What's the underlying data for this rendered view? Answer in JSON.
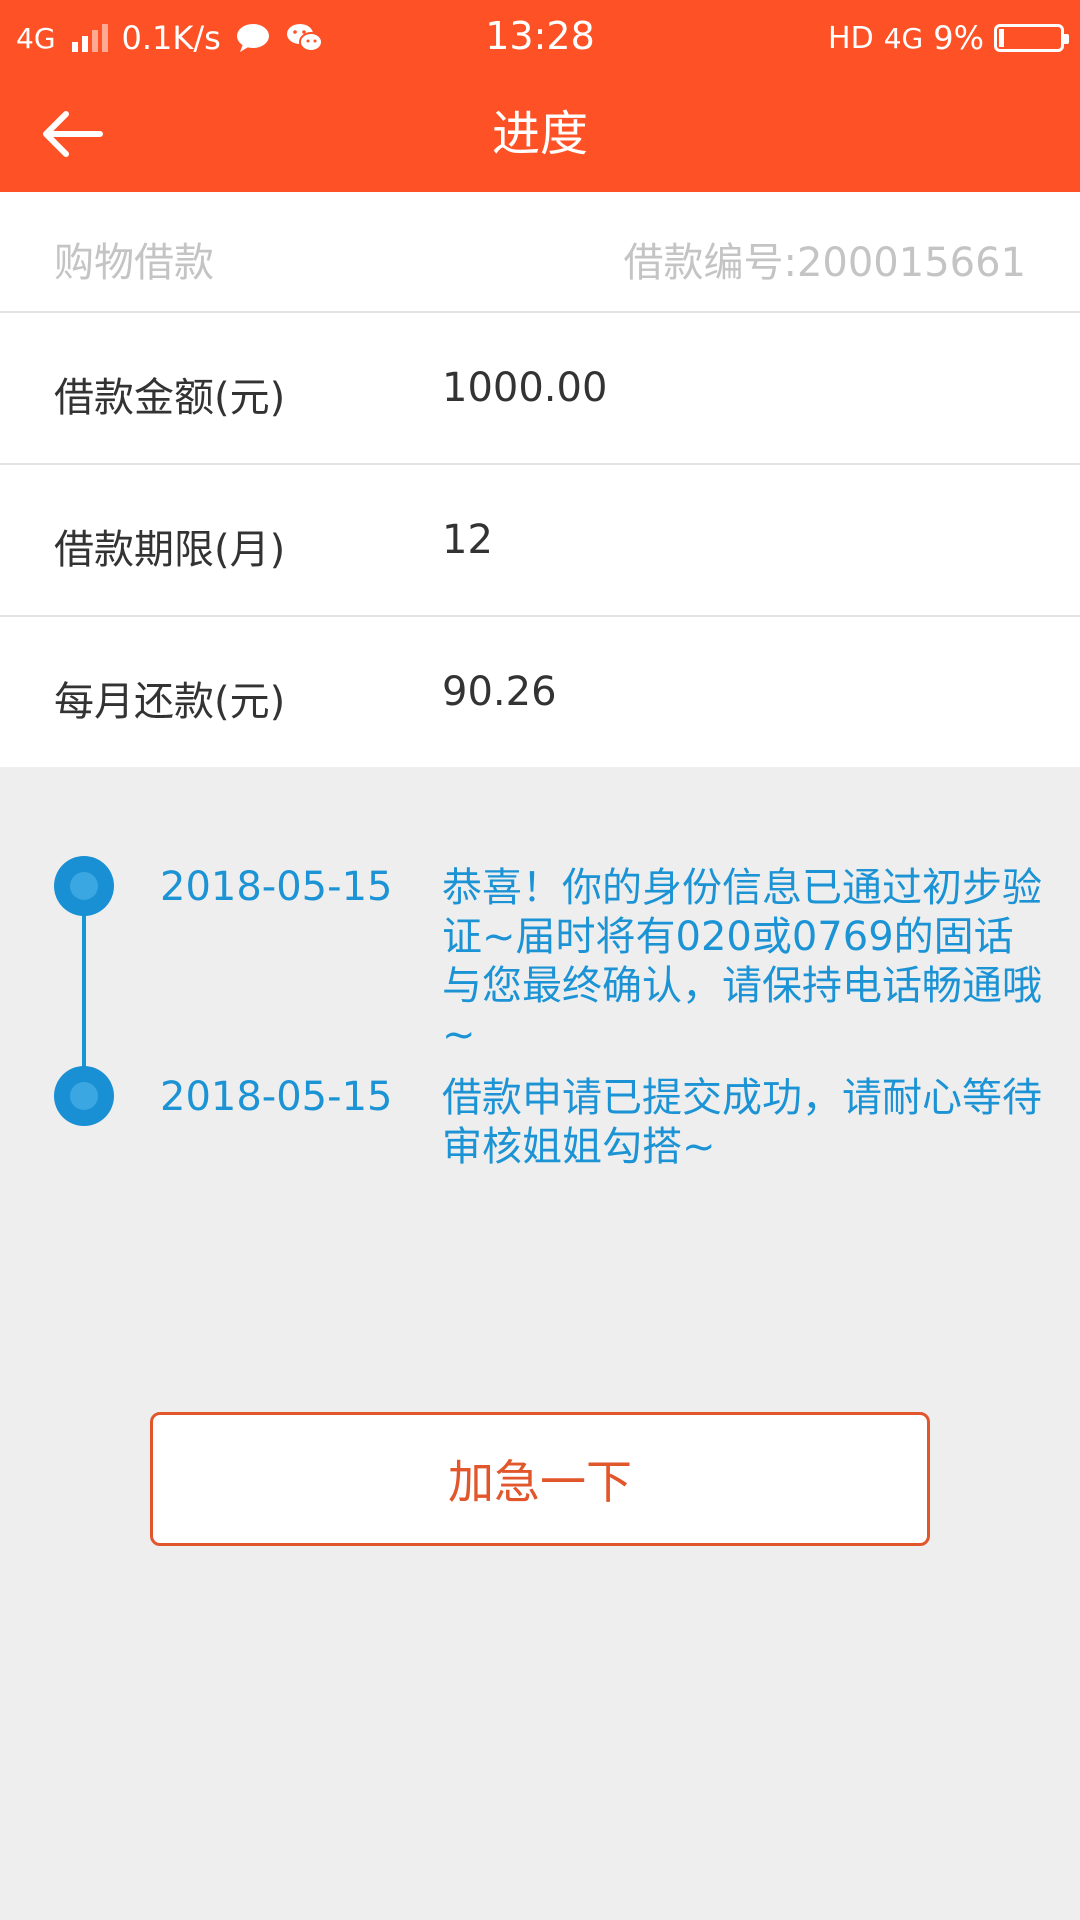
{
  "status_bar": {
    "network": "4G",
    "speed": "0.1K/s",
    "time": "13:28",
    "hd": "HD",
    "network_right": "4G",
    "battery": "9%",
    "battery_level": 0.09
  },
  "nav": {
    "title": "进度"
  },
  "loan": {
    "type": "购物借款",
    "number_label": "借款编号:200015661",
    "rows": [
      {
        "label": "借款金额(元)",
        "value": "1000.00"
      },
      {
        "label": "借款期限(月)",
        "value": "12"
      },
      {
        "label": "每月还款(元)",
        "value": "90.26"
      }
    ]
  },
  "timeline": [
    {
      "date": "2018-05-15",
      "text": "恭喜！你的身份信息已通过初步验证~届时将有020或0769的固话与您最终确认，请保持电话畅通哦~"
    },
    {
      "date": "2018-05-15",
      "text": "借款申请已提交成功，请耐心等待审核姐姐勾搭~"
    }
  ],
  "actions": {
    "urge_label": "加急一下"
  },
  "colors": {
    "header": "#fe5226",
    "timeline": "#1b93d4",
    "button": "#e2562c"
  }
}
